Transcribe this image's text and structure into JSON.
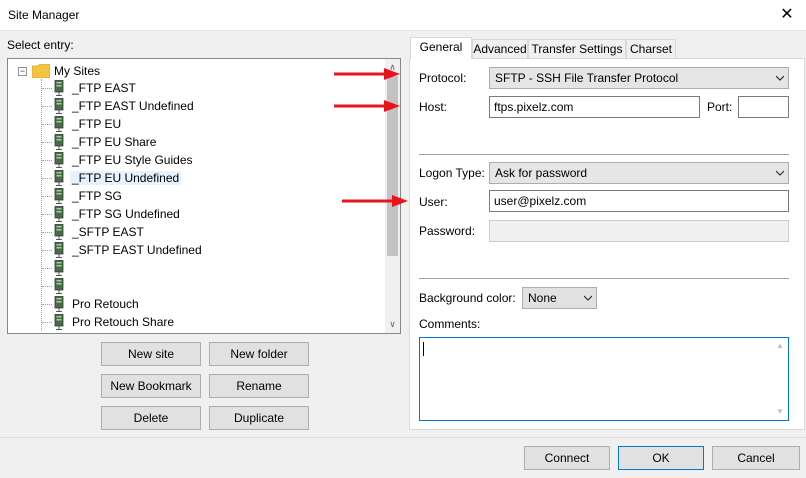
{
  "window": {
    "title": "Site Manager",
    "close_glyph": "✕"
  },
  "left": {
    "select_entry_label": "Select entry:",
    "tree": {
      "root_label": "My Sites",
      "expander_glyph": "−",
      "items": [
        {
          "label": "_FTP EAST",
          "selected": false
        },
        {
          "label": "_FTP EAST Undefined",
          "selected": false
        },
        {
          "label": "_FTP EU",
          "selected": false
        },
        {
          "label": "_FTP EU Share",
          "selected": false
        },
        {
          "label": "_FTP EU Style Guides",
          "selected": false
        },
        {
          "label": "_FTP EU Undefined",
          "selected": true
        },
        {
          "label": "_FTP SG",
          "selected": false
        },
        {
          "label": "_FTP SG Undefined",
          "selected": false
        },
        {
          "label": "_SFTP EAST",
          "selected": false
        },
        {
          "label": "_SFTP EAST Undefined",
          "selected": false
        },
        {
          "label": "",
          "selected": false
        },
        {
          "label": "",
          "selected": false
        },
        {
          "label": "Pro Retouch",
          "selected": false
        },
        {
          "label": "Pro Retouch Share",
          "selected": false
        }
      ],
      "scroll_up_glyph": "∧",
      "scroll_down_glyph": "∨"
    },
    "buttons": {
      "new_site": "New site",
      "new_folder": "New folder",
      "new_bookmark": "New Bookmark",
      "rename": "Rename",
      "delete": "Delete",
      "duplicate": "Duplicate"
    }
  },
  "right": {
    "tabs": [
      "General",
      "Advanced",
      "Transfer Settings",
      "Charset"
    ],
    "active_tab": "General",
    "protocol": {
      "label": "Protocol:",
      "value": "SFTP - SSH File Transfer Protocol"
    },
    "host": {
      "label": "Host:",
      "value": "ftps.pixelz.com"
    },
    "port": {
      "label": "Port:",
      "value": ""
    },
    "logon_type": {
      "label": "Logon Type:",
      "value": "Ask for password"
    },
    "user": {
      "label": "User:",
      "value": "user@pixelz.com"
    },
    "password": {
      "label": "Password:",
      "value": ""
    },
    "background_color": {
      "label": "Background color:",
      "value": "None"
    },
    "comments": {
      "label": "Comments:",
      "value": ""
    }
  },
  "footer": {
    "connect": "Connect",
    "ok": "OK",
    "cancel": "Cancel"
  },
  "colors": {
    "annotation_arrow": "#e8141c",
    "focus_border": "#0078d7",
    "folder": "#f5c344"
  }
}
